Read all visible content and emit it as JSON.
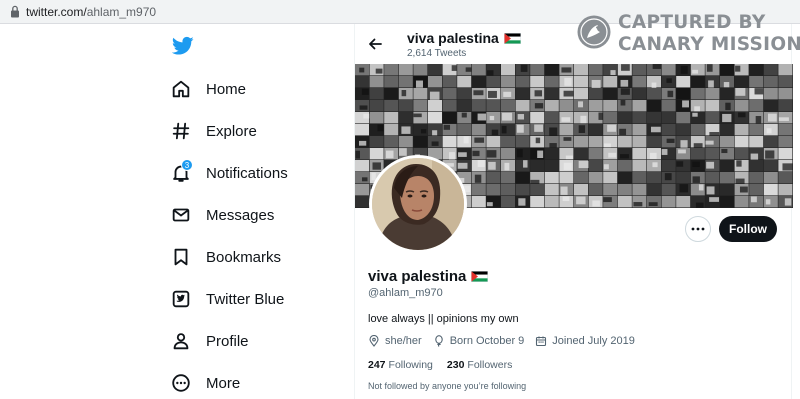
{
  "browser": {
    "url_domain": "twitter.com/",
    "url_path": "ahlam_m970"
  },
  "watermark": {
    "line1": "CAPTURED BY",
    "line2": "CANARY MISSION"
  },
  "nav": {
    "logo_icon": "twitter-bird-icon",
    "items": [
      {
        "label": "Home",
        "icon": "home-icon"
      },
      {
        "label": "Explore",
        "icon": "hashtag-icon"
      },
      {
        "label": "Notifications",
        "icon": "bell-icon",
        "badge": "3"
      },
      {
        "label": "Messages",
        "icon": "envelope-icon"
      },
      {
        "label": "Bookmarks",
        "icon": "bookmark-icon"
      },
      {
        "label": "Twitter Blue",
        "icon": "twitter-blue-icon"
      },
      {
        "label": "Profile",
        "icon": "person-icon"
      },
      {
        "label": "More",
        "icon": "more-circle-icon"
      }
    ]
  },
  "profile": {
    "header_name": "viva palestina",
    "tweet_count": "2,614 Tweets",
    "display_name": "viva palestina",
    "handle": "@ahlam_m970",
    "bio": "love always || opinions my own",
    "pronouns": "she/her",
    "born": "Born October 9",
    "joined": "Joined July 2019",
    "following_count": "247",
    "following_label": "Following",
    "followers_count": "230",
    "followers_label": "Followers",
    "not_followed": "Not followed by anyone you’re following",
    "follow_label": "Follow"
  },
  "colors": {
    "accent": "#1d9bf0",
    "text": "#0f1419",
    "muted": "#536471",
    "follow_bg": "#0f1419"
  }
}
